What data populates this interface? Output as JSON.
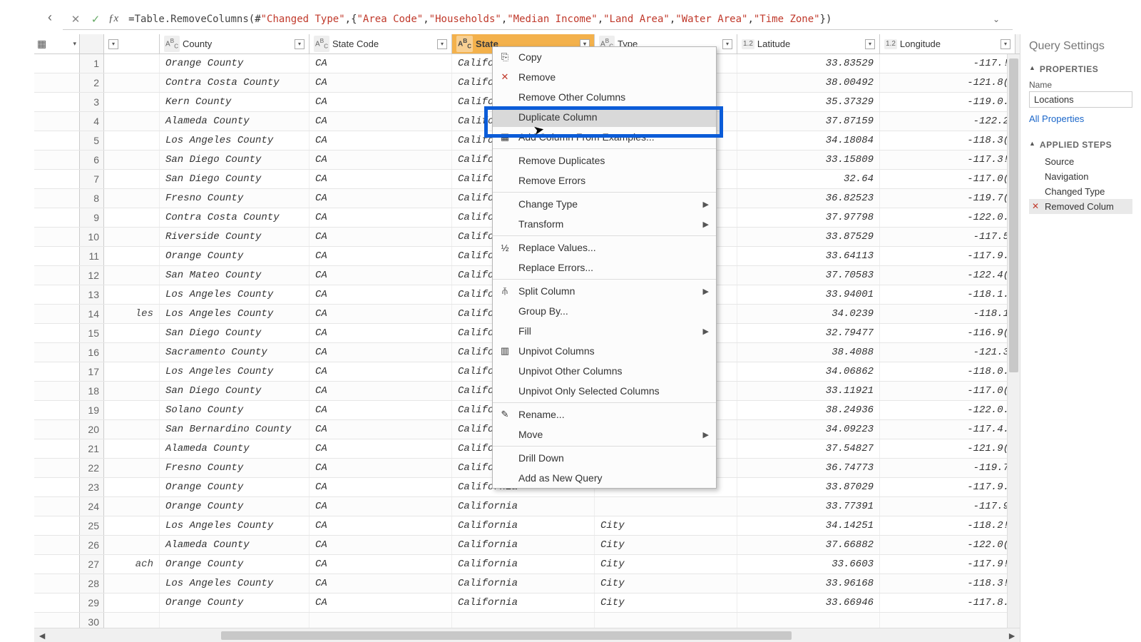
{
  "formula": {
    "prefix": "= ",
    "fn": "Table.RemoveColumns",
    "open": "(#",
    "ref": "\"Changed Type\"",
    "mid": ",{",
    "cols": [
      "\"Area Code\"",
      "\"Households\"",
      "\"Median Income\"",
      "\"Land Area\"",
      "\"Water Area\"",
      "\"Time Zone\""
    ],
    "close": "})"
  },
  "headers": {
    "county": "County",
    "state_code": "State Code",
    "state": "State",
    "type": "Type",
    "lat": "Latitude",
    "lon": "Longitude",
    "txt_badge": "A<sup>B</sup><sub>C</sub>",
    "num_badge": "1.2"
  },
  "rows": [
    {
      "n": 1,
      "spill": "",
      "county": "Orange County",
      "code": "CA",
      "state": "California",
      "type": "",
      "lat": "33.83529",
      "lon": "-117.!"
    },
    {
      "n": 2,
      "spill": "",
      "county": "Contra Costa County",
      "code": "CA",
      "state": "California",
      "type": "",
      "lat": "38.00492",
      "lon": "-121.8("
    },
    {
      "n": 3,
      "spill": "",
      "county": "Kern County",
      "code": "CA",
      "state": "California",
      "type": "",
      "lat": "35.37329",
      "lon": "-119.0."
    },
    {
      "n": 4,
      "spill": "",
      "county": "Alameda County",
      "code": "CA",
      "state": "California",
      "type": "",
      "lat": "37.87159",
      "lon": "-122.2"
    },
    {
      "n": 5,
      "spill": "",
      "county": "Los Angeles County",
      "code": "CA",
      "state": "California",
      "type": "",
      "lat": "34.18084",
      "lon": "-118.3("
    },
    {
      "n": 6,
      "spill": "",
      "county": "San Diego County",
      "code": "CA",
      "state": "California",
      "type": "",
      "lat": "33.15809",
      "lon": "-117.3!"
    },
    {
      "n": 7,
      "spill": "",
      "county": "San Diego County",
      "code": "CA",
      "state": "California",
      "type": "",
      "lat": "32.64",
      "lon": "-117.0("
    },
    {
      "n": 8,
      "spill": "",
      "county": "Fresno County",
      "code": "CA",
      "state": "California",
      "type": "",
      "lat": "36.82523",
      "lon": "-119.7("
    },
    {
      "n": 9,
      "spill": "",
      "county": "Contra Costa County",
      "code": "CA",
      "state": "California",
      "type": "",
      "lat": "37.97798",
      "lon": "-122.0."
    },
    {
      "n": 10,
      "spill": "",
      "county": "Riverside County",
      "code": "CA",
      "state": "California",
      "type": "",
      "lat": "33.87529",
      "lon": "-117.5"
    },
    {
      "n": 11,
      "spill": "",
      "county": "Orange County",
      "code": "CA",
      "state": "California",
      "type": "",
      "lat": "33.64113",
      "lon": "-117.9."
    },
    {
      "n": 12,
      "spill": "",
      "county": "San Mateo County",
      "code": "CA",
      "state": "California",
      "type": "",
      "lat": "37.70583",
      "lon": "-122.4("
    },
    {
      "n": 13,
      "spill": "",
      "county": "Los Angeles County",
      "code": "CA",
      "state": "California",
      "type": "",
      "lat": "33.94001",
      "lon": "-118.1."
    },
    {
      "n": 14,
      "spill": "les",
      "county": "Los Angeles County",
      "code": "CA",
      "state": "California",
      "type": "",
      "lat": "34.0239",
      "lon": "-118.1"
    },
    {
      "n": 15,
      "spill": "",
      "county": "San Diego County",
      "code": "CA",
      "state": "California",
      "type": "",
      "lat": "32.79477",
      "lon": "-116.9("
    },
    {
      "n": 16,
      "spill": "",
      "county": "Sacramento County",
      "code": "CA",
      "state": "California",
      "type": "",
      "lat": "38.4088",
      "lon": "-121.3"
    },
    {
      "n": 17,
      "spill": "",
      "county": "Los Angeles County",
      "code": "CA",
      "state": "California",
      "type": "",
      "lat": "34.06862",
      "lon": "-118.0."
    },
    {
      "n": 18,
      "spill": "",
      "county": "San Diego County",
      "code": "CA",
      "state": "California",
      "type": "",
      "lat": "33.11921",
      "lon": "-117.0("
    },
    {
      "n": 19,
      "spill": "",
      "county": "Solano County",
      "code": "CA",
      "state": "California",
      "type": "",
      "lat": "38.24936",
      "lon": "-122.0."
    },
    {
      "n": 20,
      "spill": "",
      "county": "San Bernardino County",
      "code": "CA",
      "state": "California",
      "type": "",
      "lat": "34.09223",
      "lon": "-117.4."
    },
    {
      "n": 21,
      "spill": "",
      "county": "Alameda County",
      "code": "CA",
      "state": "California",
      "type": "",
      "lat": "37.54827",
      "lon": "-121.9("
    },
    {
      "n": 22,
      "spill": "",
      "county": "Fresno County",
      "code": "CA",
      "state": "California",
      "type": "",
      "lat": "36.74773",
      "lon": "-119.7"
    },
    {
      "n": 23,
      "spill": "",
      "county": "Orange County",
      "code": "CA",
      "state": "California",
      "type": "",
      "lat": "33.87029",
      "lon": "-117.9."
    },
    {
      "n": 24,
      "spill": "",
      "county": "Orange County",
      "code": "CA",
      "state": "California",
      "type": "",
      "lat": "33.77391",
      "lon": "-117.9"
    },
    {
      "n": 25,
      "spill": "",
      "county": "Los Angeles County",
      "code": "CA",
      "state": "California",
      "type": "City",
      "lat": "34.14251",
      "lon": "-118.2!"
    },
    {
      "n": 26,
      "spill": "",
      "county": "Alameda County",
      "code": "CA",
      "state": "California",
      "type": "City",
      "lat": "37.66882",
      "lon": "-122.0("
    },
    {
      "n": 27,
      "spill": "ach",
      "county": "Orange County",
      "code": "CA",
      "state": "California",
      "type": "City",
      "lat": "33.6603",
      "lon": "-117.9!"
    },
    {
      "n": 28,
      "spill": "",
      "county": "Los Angeles County",
      "code": "CA",
      "state": "California",
      "type": "City",
      "lat": "33.96168",
      "lon": "-118.3!"
    },
    {
      "n": 29,
      "spill": "",
      "county": "Orange County",
      "code": "CA",
      "state": "California",
      "type": "City",
      "lat": "33.66946",
      "lon": "-117.8."
    },
    {
      "n": 30,
      "spill": "",
      "county": "",
      "code": "",
      "state": "",
      "type": "",
      "lat": "",
      "lon": ""
    }
  ],
  "menu": {
    "items": [
      {
        "label": "Copy",
        "icon": "⎘"
      },
      {
        "label": "Remove",
        "icon": "✕",
        "iconColor": "#c0392b"
      },
      {
        "label": "Remove Other Columns"
      },
      {
        "label": "Duplicate Column",
        "hl": true
      },
      {
        "label": "Add Column From Examples...",
        "icon": "▦"
      },
      {
        "sep": true
      },
      {
        "label": "Remove Duplicates"
      },
      {
        "label": "Remove Errors"
      },
      {
        "sep": true
      },
      {
        "label": "Change Type",
        "sub": true
      },
      {
        "label": "Transform",
        "sub": true
      },
      {
        "sep": true
      },
      {
        "label": "Replace Values...",
        "icon": "½"
      },
      {
        "label": "Replace Errors..."
      },
      {
        "sep": true
      },
      {
        "label": "Split Column",
        "sub": true,
        "icon": "⫚"
      },
      {
        "label": "Group By..."
      },
      {
        "label": "Fill",
        "sub": true
      },
      {
        "label": "Unpivot Columns",
        "icon": "▥"
      },
      {
        "label": "Unpivot Other Columns"
      },
      {
        "label": "Unpivot Only Selected Columns"
      },
      {
        "sep": true
      },
      {
        "label": "Rename...",
        "icon": "✎"
      },
      {
        "label": "Move",
        "sub": true
      },
      {
        "sep": true
      },
      {
        "label": "Drill Down"
      },
      {
        "label": "Add as New Query"
      }
    ]
  },
  "panel": {
    "title": "Query Settings",
    "props": "PROPERTIES",
    "name_lbl": "Name",
    "name_val": "Locations",
    "all_props": "All Properties",
    "steps_hdr": "APPLIED STEPS",
    "steps": [
      {
        "label": "Source"
      },
      {
        "label": "Navigation"
      },
      {
        "label": "Changed Type"
      },
      {
        "label": "Removed Colum",
        "sel": true,
        "x": true
      }
    ]
  }
}
